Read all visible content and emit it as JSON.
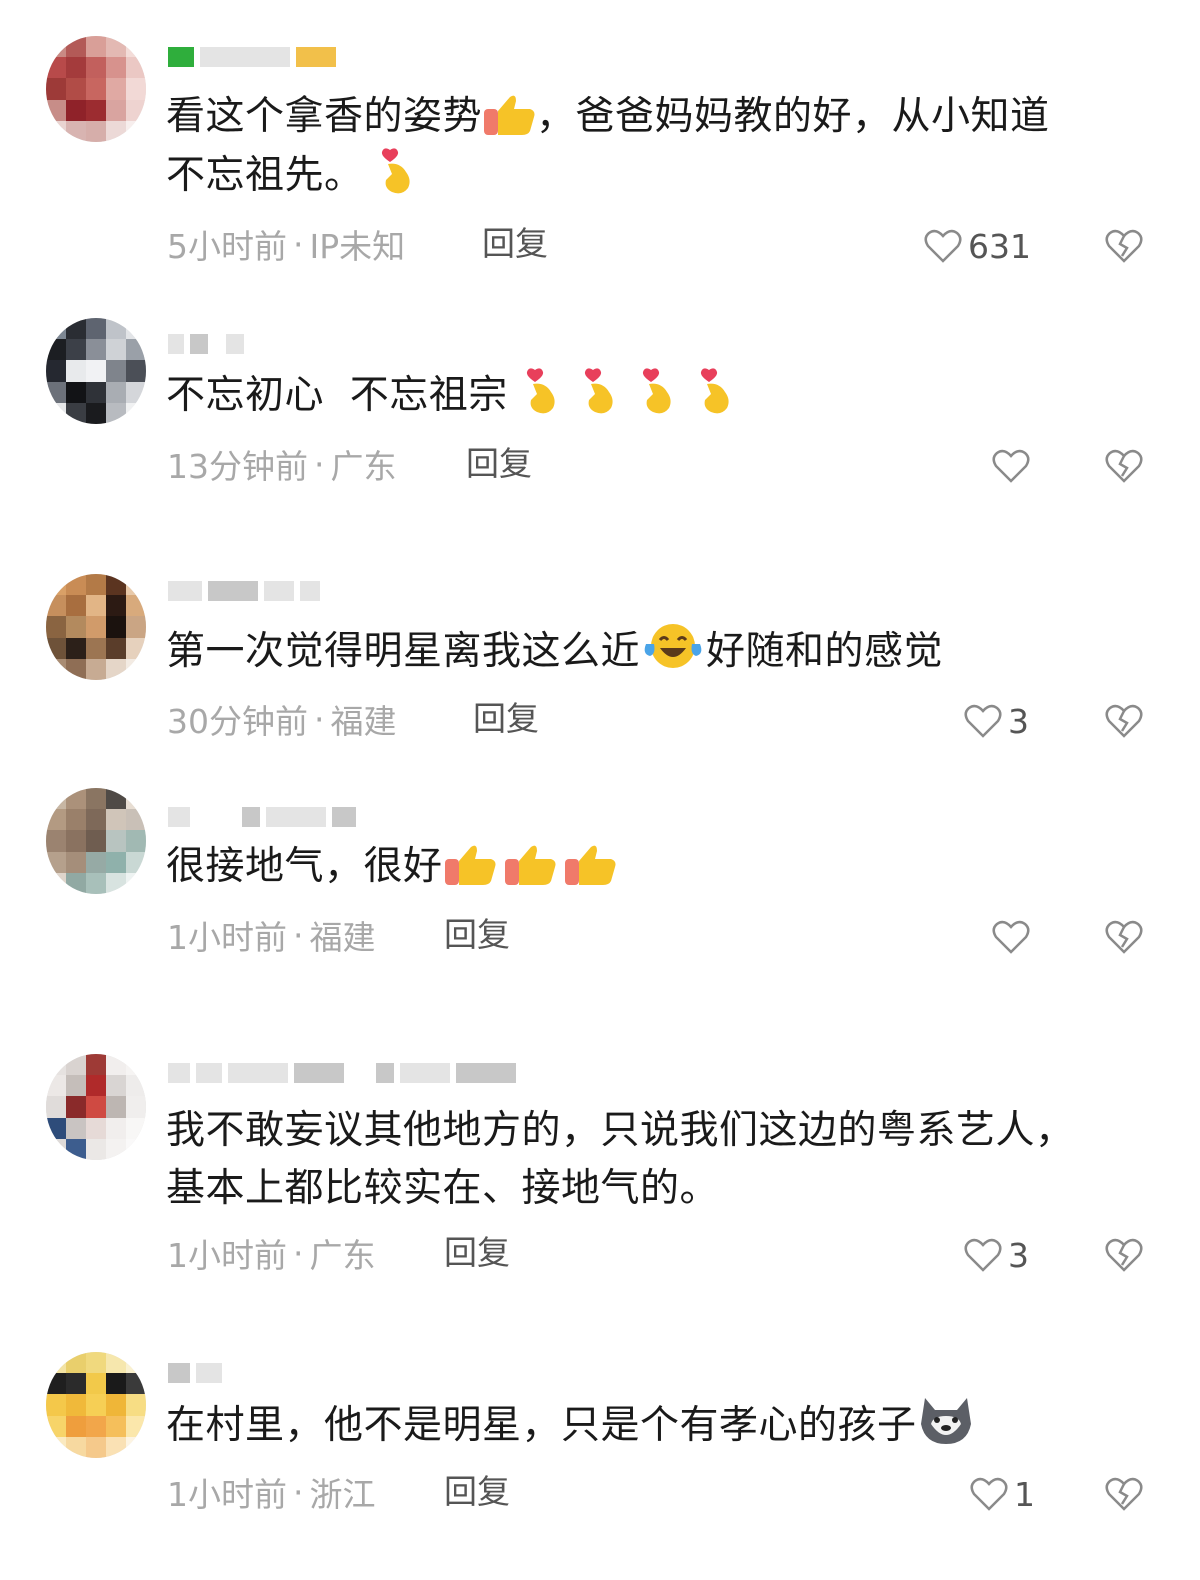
{
  "colors": {
    "text": "#1a1a1a",
    "meta": "#a8a8a8",
    "reply": "#555555",
    "icon_stroke": "#8a8a8a"
  },
  "comments": [
    {
      "username_masked": true,
      "text_parts": [
        "看这个拿香的姿势",
        "，爸爸妈妈教的好，从小知道",
        "不忘祖先。"
      ],
      "emojis": [
        "thumbs-up-emoji",
        "finger-heart-emoji"
      ],
      "time": "5小时前",
      "location": "IP未知",
      "reply_label": "回复",
      "likes": "631"
    },
    {
      "username_masked": true,
      "text_parts": [
        "不忘初心  不忘祖宗"
      ],
      "emojis": [
        "finger-heart-emoji",
        "finger-heart-emoji",
        "finger-heart-emoji",
        "finger-heart-emoji"
      ],
      "time": "13分钟前",
      "location": "广东",
      "reply_label": "回复",
      "likes": ""
    },
    {
      "username_masked": true,
      "text_parts": [
        "第一次觉得明星离我这么近",
        "好随和的感觉"
      ],
      "emojis": [
        "tears-of-joy-emoji"
      ],
      "time": "30分钟前",
      "location": "福建",
      "reply_label": "回复",
      "likes": "3"
    },
    {
      "username_masked": true,
      "text_parts": [
        "很接地气，很好"
      ],
      "emojis": [
        "thumbs-up-emoji",
        "thumbs-up-emoji",
        "thumbs-up-emoji"
      ],
      "time": "1小时前",
      "location": "福建",
      "reply_label": "回复",
      "likes": ""
    },
    {
      "username_masked": true,
      "text_parts": [
        "我不敢妄议其他地方的，只说我们这边的粤系艺人，",
        "基本上都比较实在、接地气的。"
      ],
      "emojis": [],
      "time": "1小时前",
      "location": "广东",
      "reply_label": "回复",
      "likes": "3"
    },
    {
      "username_masked": true,
      "text_parts": [
        "在村里，他不是明星，只是个有孝心的孩子"
      ],
      "emojis": [
        "husky-dog-emoji"
      ],
      "time": "1小时前",
      "location": "浙江",
      "reply_label": "回复",
      "likes": "1"
    }
  ]
}
